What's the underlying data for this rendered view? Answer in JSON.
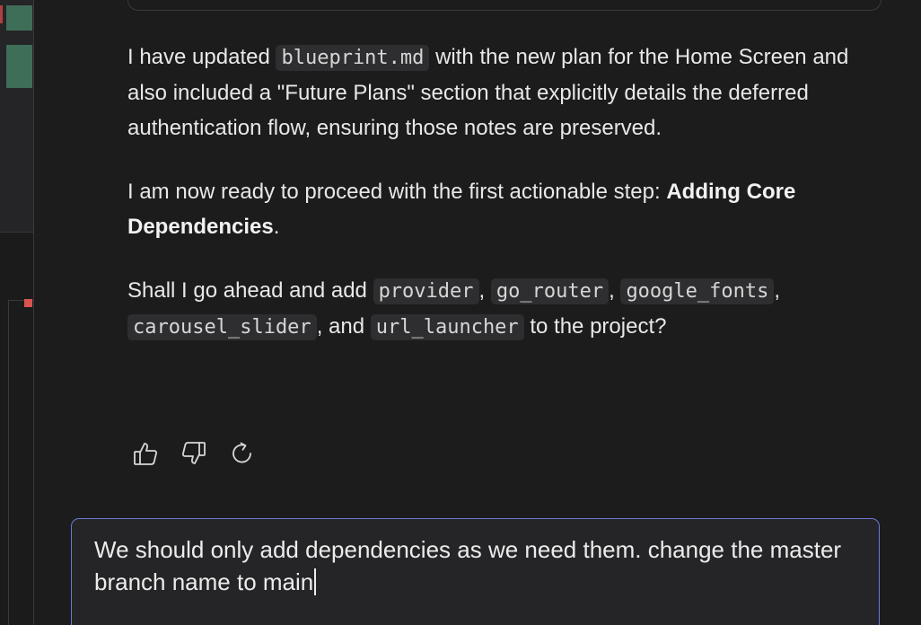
{
  "message": {
    "p1": {
      "t1": "I have updated ",
      "code1": "blueprint.md",
      "t2": " with the new plan for the Home Screen and also included a \"Future Plans\" section that explicitly details the deferred authentication flow, ensuring those notes are preserved."
    },
    "p2": {
      "t1": "I am now ready to proceed with the first actionable step: ",
      "bold": "Adding Core Dependencies",
      "t2": "."
    },
    "p3": {
      "t1": "Shall I go ahead and add ",
      "dep1": "provider",
      "sep1": ", ",
      "dep2": "go_router",
      "sep2": ", ",
      "dep3": "google_fonts",
      "sep3": ", ",
      "dep4": "carousel_slider",
      "sep4": ", and ",
      "dep5": "url_launcher",
      "t2": " to the project?"
    }
  },
  "feedback": {
    "icons": [
      "thumbs-up-icon",
      "thumbs-down-icon",
      "regenerate-icon"
    ]
  },
  "input": {
    "value": "We should only add dependencies as we need them. change the master branch name to main"
  },
  "colors": {
    "background": "#1c1c1d",
    "input_border": "#6b78d6",
    "sidebar_green": "#3f6e58",
    "sidebar_red": "#d9534f"
  }
}
